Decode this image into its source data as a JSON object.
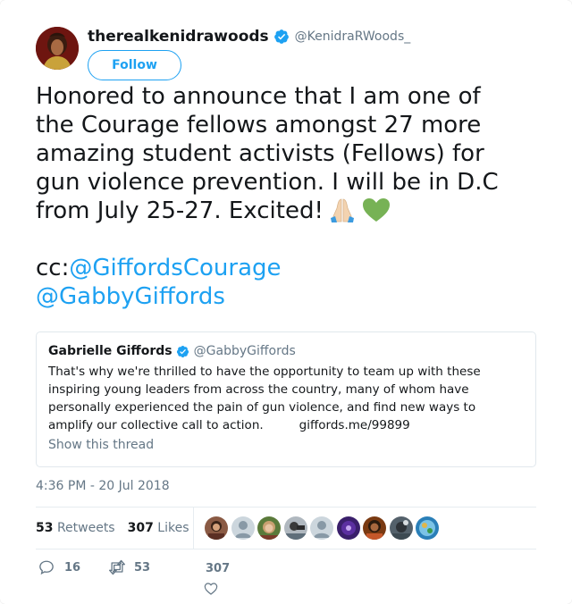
{
  "author": {
    "display_name": "therealkenidrawoods",
    "handle": "@KenidraRWoods_",
    "verified": true,
    "avatar_icon": "user-avatar"
  },
  "follow_label": "Follow",
  "tweet": {
    "lines": [
      "Honored to announce that I am one of",
      "the Courage fellows amongst 27 more",
      "amazing student activists (Fellows) for",
      "gun violence prevention. I will be in D.C",
      "from July 25-27. Excited!"
    ],
    "emojis": [
      "folded-hands-icon",
      "green-heart-icon"
    ],
    "cc_prefix": "cc:",
    "mentions": [
      "@GiffordsCourage",
      "@GabbyGiffords"
    ]
  },
  "quoted_tweet": {
    "display_name": "Gabrielle Giffords",
    "handle": "@GabbyGiffords",
    "verified": true,
    "lines": [
      "That's why we're thrilled to have the opportunity to team up with these",
      "inspiring young leaders from across the country, many of whom have",
      "personally experienced the pain of gun violence, and find new ways to",
      "amplify our collective call to action."
    ],
    "link": "giffords.me/99899",
    "show_thread": "Show this thread"
  },
  "timestamp": "4:36 PM - 20 Jul 2018",
  "stats": {
    "retweets_count": "53",
    "retweets_label": "Retweets",
    "likes_count": "307",
    "likes_label": "Likes",
    "liker_avatar_count": 9
  },
  "actions": {
    "reply_count": "16",
    "retweet_count": "53",
    "like_count": "307"
  },
  "colors": {
    "accent": "#1da1f2",
    "text": "#14171a",
    "muted": "#657786",
    "border": "#e1e8ed"
  }
}
